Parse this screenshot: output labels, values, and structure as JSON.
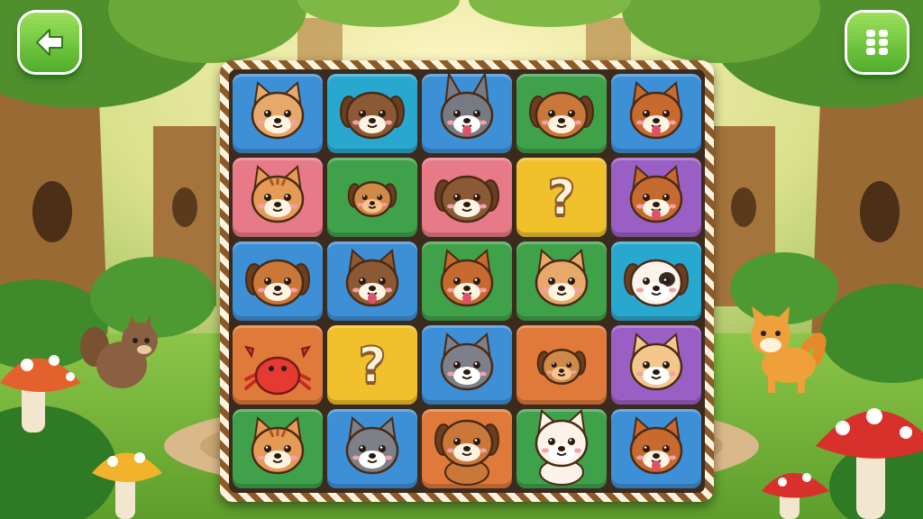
{
  "scene": {
    "name": "forest-clearing"
  },
  "buttons": {
    "back": {
      "icon": "arrow-left-icon"
    },
    "menu": {
      "icon": "grid-menu-icon"
    }
  },
  "colors": {
    "blue": "#3d8fd6",
    "green": "#3fa24a",
    "pink": "#e77a86",
    "yellow": "#f0c12a",
    "purple": "#9a5fc4",
    "orange": "#e07a3a",
    "cyan": "#29a8cf"
  },
  "board": {
    "rows": 5,
    "cols": 5,
    "tiles": [
      [
        {
          "color": "blue",
          "content": "cat-face",
          "icon": "cat-face-icon"
        },
        {
          "color": "cyan",
          "content": "dog-face",
          "icon": "dog-face-icon"
        },
        {
          "color": "blue",
          "content": "husky-face",
          "icon": "husky-face-icon"
        },
        {
          "color": "green",
          "content": "puppy-face",
          "icon": "puppy-face-icon"
        },
        {
          "color": "blue",
          "content": "corgi-face",
          "icon": "corgi-face-icon"
        }
      ],
      [
        {
          "color": "pink",
          "content": "tabby-cat-face",
          "icon": "tabby-cat-face-icon"
        },
        {
          "color": "green",
          "content": "small-puppy",
          "icon": "small-puppy-icon"
        },
        {
          "color": "pink",
          "content": "dog-face",
          "icon": "dog-face-icon"
        },
        {
          "color": "yellow",
          "content": "question",
          "icon": "question-mark-icon",
          "text": "?"
        },
        {
          "color": "purple",
          "content": "corgi-face",
          "icon": "corgi-face-icon"
        }
      ],
      [
        {
          "color": "blue",
          "content": "puppy-face",
          "icon": "puppy-face-icon"
        },
        {
          "color": "blue",
          "content": "wolf-dog-face",
          "icon": "wolf-dog-face-icon"
        },
        {
          "color": "green",
          "content": "corgi-face",
          "icon": "corgi-face-icon"
        },
        {
          "color": "green",
          "content": "cat-face",
          "icon": "cat-face-icon"
        },
        {
          "color": "cyan",
          "content": "white-dog-face",
          "icon": "white-dog-face-icon"
        }
      ],
      [
        {
          "color": "orange",
          "content": "crab",
          "icon": "crab-icon"
        },
        {
          "color": "yellow",
          "content": "question",
          "icon": "question-mark-icon",
          "text": "?"
        },
        {
          "color": "blue",
          "content": "gray-cat-face",
          "icon": "gray-cat-face-icon"
        },
        {
          "color": "orange",
          "content": "small-puppy",
          "icon": "small-puppy-icon"
        },
        {
          "color": "purple",
          "content": "calico-cat-face",
          "icon": "calico-cat-face-icon"
        }
      ],
      [
        {
          "color": "green",
          "content": "tabby-cat-face",
          "icon": "tabby-cat-face-icon"
        },
        {
          "color": "blue",
          "content": "gray-cat-face",
          "icon": "gray-cat-face-icon"
        },
        {
          "color": "orange",
          "content": "puppy-body",
          "icon": "puppy-body-icon"
        },
        {
          "color": "green",
          "content": "white-cat",
          "icon": "white-cat-icon"
        },
        {
          "color": "blue",
          "content": "corgi-face",
          "icon": "corgi-face-icon"
        }
      ]
    ]
  },
  "decorations": [
    {
      "name": "squirrel",
      "icon": "squirrel-icon"
    },
    {
      "name": "fox",
      "icon": "fox-icon"
    },
    {
      "name": "mushroom-orange",
      "icon": "mushroom-icon"
    },
    {
      "name": "mushroom-yellow",
      "icon": "mushroom-icon"
    },
    {
      "name": "mushroom-red",
      "icon": "mushroom-icon"
    }
  ]
}
